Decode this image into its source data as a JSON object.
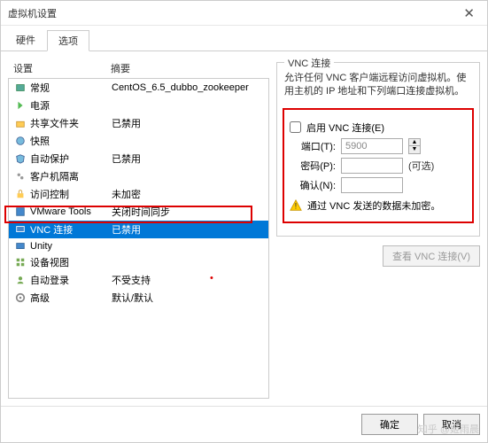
{
  "window": {
    "title": "虚拟机设置"
  },
  "tabs": {
    "hw": "硬件",
    "opt": "选项"
  },
  "listhead": {
    "c1": "设置",
    "c2": "摘要"
  },
  "rows": [
    {
      "icon": "general",
      "label": "常规",
      "summary": "CentOS_6.5_dubbo_zookeeper"
    },
    {
      "icon": "power",
      "label": "电源",
      "summary": ""
    },
    {
      "icon": "shared",
      "label": "共享文件夹",
      "summary": "已禁用"
    },
    {
      "icon": "snapshot",
      "label": "快照",
      "summary": ""
    },
    {
      "icon": "autoprotect",
      "label": "自动保护",
      "summary": "已禁用"
    },
    {
      "icon": "guest",
      "label": "客户机隔离",
      "summary": ""
    },
    {
      "icon": "access",
      "label": "访问控制",
      "summary": "未加密"
    },
    {
      "icon": "vmtools",
      "label": "VMware Tools",
      "summary": "关闭时间同步"
    },
    {
      "icon": "vnc",
      "label": "VNC 连接",
      "summary": "已禁用"
    },
    {
      "icon": "unity",
      "label": "Unity",
      "summary": ""
    },
    {
      "icon": "appview",
      "label": "设备视图",
      "summary": ""
    },
    {
      "icon": "autologin",
      "label": "自动登录",
      "summary": "不受支持"
    },
    {
      "icon": "advanced",
      "label": "高级",
      "summary": "默认/默认"
    }
  ],
  "right": {
    "title": "VNC 连接",
    "desc": "允许任何 VNC 客户端远程访问虚拟机。使用主机的 IP 地址和下列端口连接虚拟机。",
    "enable": "启用 VNC 连接(E)",
    "port_l": "端口(T):",
    "port_v": "5900",
    "pass_l": "密码(P):",
    "pass_hint": "(可选)",
    "conf_l": "确认(N):",
    "warn": "通过 VNC 发送的数据未加密。",
    "viewbtn": "查看 VNC 连接(V)"
  },
  "footer": {
    "ok": "确定",
    "cancel": "取消"
  },
  "wm": "知乎 @姬雨晨"
}
